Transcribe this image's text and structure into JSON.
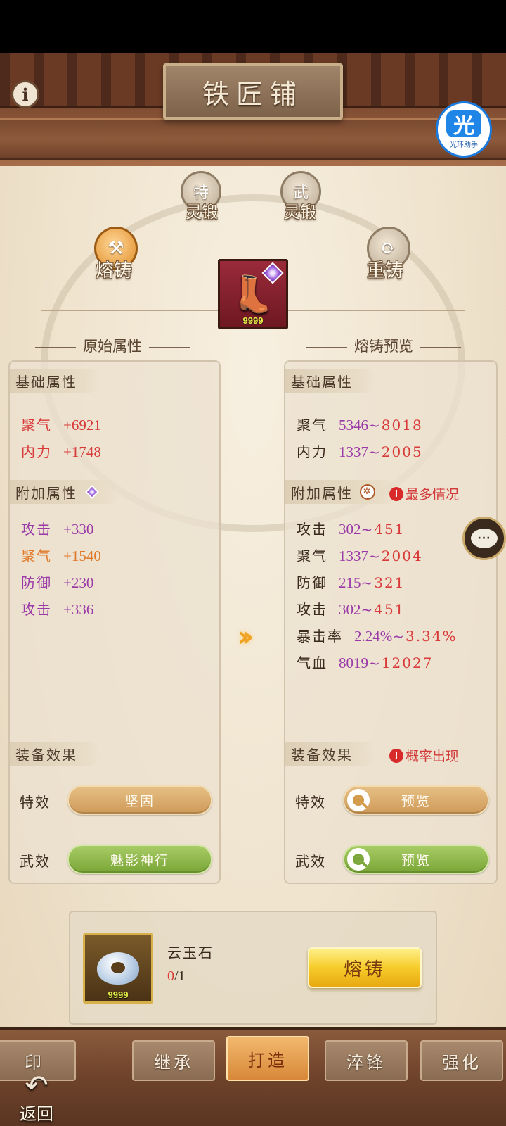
{
  "header": {
    "title": "铁匠铺",
    "info_icon": "info-icon",
    "assistant": {
      "big": "光",
      "small": "光环助手"
    }
  },
  "craft_modes": {
    "special": {
      "top": "特",
      "label": "灵锻"
    },
    "martial": {
      "top": "武",
      "label": "灵锻"
    },
    "fuse": {
      "label": "熔铸",
      "active": true
    },
    "reforge": {
      "label": "重铸"
    }
  },
  "equipment": {
    "icon": "boots-icon",
    "quantity": "9999"
  },
  "left": {
    "section_title": "原始属性",
    "base_tag": "基础属性",
    "base_stats": [
      {
        "name": "聚气",
        "value": "+6921"
      },
      {
        "name": "内力",
        "value": "+1748"
      }
    ],
    "extra_tag": "附加属性",
    "extra_stats": [
      {
        "name": "攻击",
        "value": "+330"
      },
      {
        "name": "聚气",
        "value": "+1540"
      },
      {
        "name": "防御",
        "value": "+230"
      },
      {
        "name": "攻击",
        "value": "+336"
      }
    ],
    "effect_tag": "装备效果",
    "special_label": "特效",
    "special_value": "坚固",
    "martial_label": "武效",
    "martial_value": "魅影神行"
  },
  "right": {
    "section_title": "熔铸预览",
    "base_tag": "基础属性",
    "base_stats": [
      {
        "name": "聚气",
        "min": "5346",
        "sep": "~",
        "max": "8018"
      },
      {
        "name": "内力",
        "min": "1337",
        "sep": "~",
        "max": "2005"
      }
    ],
    "extra_tag": "附加属性",
    "extra_warning": "最多情况",
    "extra_stats": [
      {
        "name": "攻击",
        "min": "302",
        "sep": "~",
        "max": "451"
      },
      {
        "name": "聚气",
        "min": "1337",
        "sep": "~",
        "max": "2004"
      },
      {
        "name": "防御",
        "min": "215",
        "sep": "~",
        "max": "321"
      },
      {
        "name": "攻击",
        "min": "302",
        "sep": "~",
        "max": "451"
      },
      {
        "name": "暴击率",
        "min": "2.24%",
        "sep": "~",
        "max": "3.34%"
      },
      {
        "name": "气血",
        "min": "8019",
        "sep": "~",
        "max": "12027"
      }
    ],
    "effect_tag": "装备效果",
    "effect_warning": "概率出现",
    "special_label": "特效",
    "special_button": "预览",
    "martial_label": "武效",
    "martial_button": "预览"
  },
  "chat_icon": "chat-bubble-icon",
  "chat_text": "···",
  "material": {
    "name": "云玉石",
    "have": "0",
    "need": "/1",
    "quantity": "9999",
    "forge_button": "熔铸"
  },
  "bottom_tabs": [
    "印",
    "继承",
    "打造",
    "淬锋",
    "强化"
  ],
  "active_tab": "打造",
  "back_label": "返回",
  "colors": {
    "stat_red": "#d83a3a",
    "stat_purple": "#9a3aa8",
    "stat_orange": "#e07a2a",
    "forge_gold": "#f6cc2a"
  }
}
